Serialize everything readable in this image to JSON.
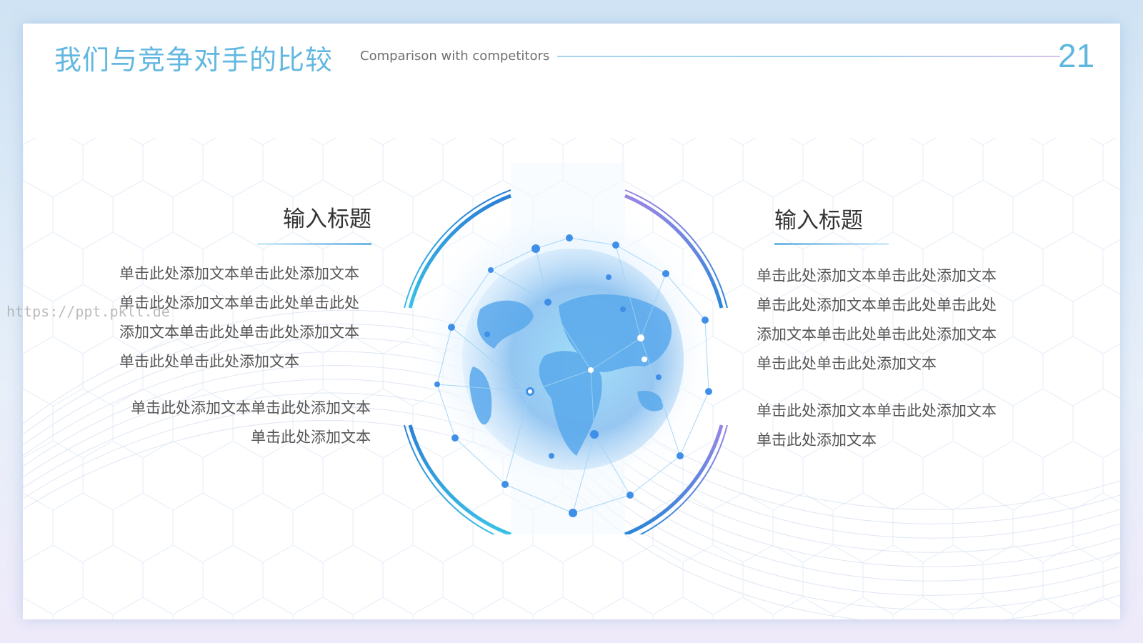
{
  "header": {
    "title_cn": "我们与竞争对手的比较",
    "title_en": "Comparison with competitors",
    "page_number": "21"
  },
  "left": {
    "heading": "输入标题",
    "paragraph_1": "单击此处添加文本单击此处添加文本单击此处添加文本单击此处单击此处添加文本单击此处单击此处添加文本单击此处单击此处添加文本",
    "paragraph_2": "单击此处添加文本单击此处添加文本单击此处添加文本"
  },
  "right": {
    "heading": "输入标题",
    "paragraph_1": "单击此处添加文本单击此处添加文本单击此处添加文本单击此处单击此处添加文本单击此处单击此处添加文本单击此处单击此处添加文本",
    "paragraph_2": "单击此处添加文本单击此处添加文本单击此处添加文本"
  },
  "watermark": "https://ppt.pkll.de",
  "center_graphic": {
    "icon": "globe-network-icon"
  },
  "colors": {
    "accent": "#62b8e0",
    "ring_blue": "#1f8fd8",
    "ring_purple": "#8b7fe0",
    "text": "#555555"
  }
}
